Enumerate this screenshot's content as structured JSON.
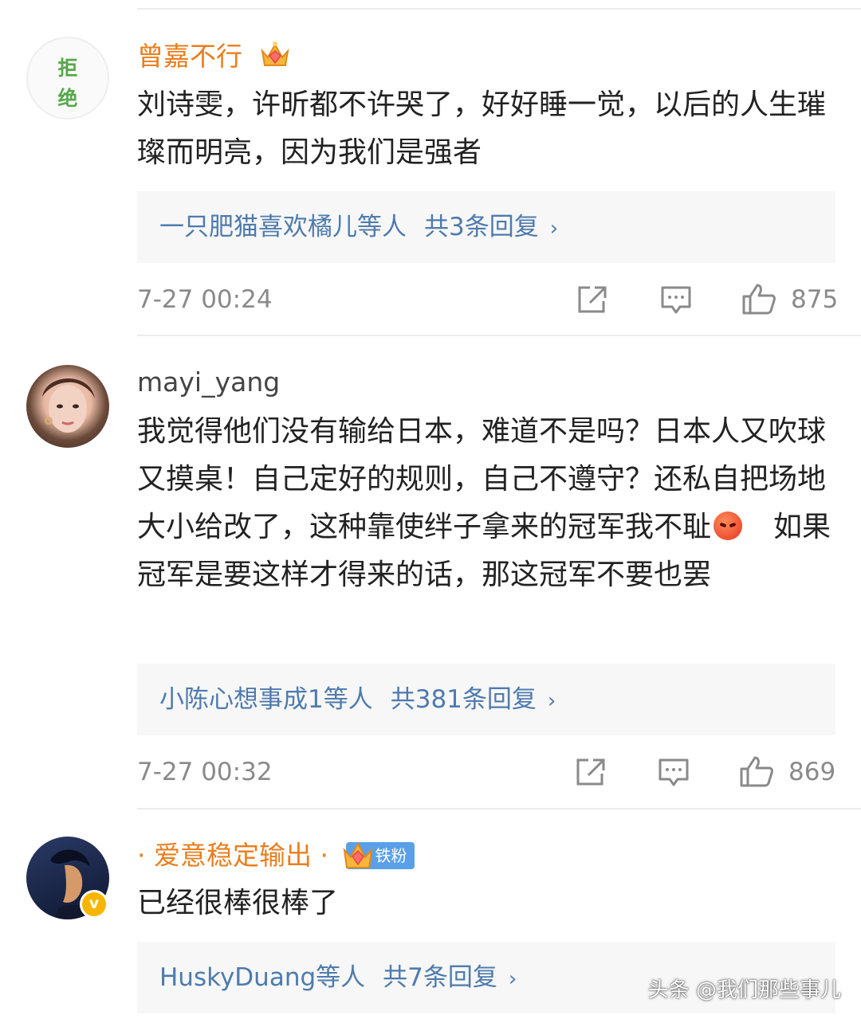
{
  "comments": [
    {
      "avatar_text": [
        "拒",
        "绝"
      ],
      "username": "曾嘉不行",
      "text": "刘诗雯，许昕都不许哭了，好好睡一觉，以后的人生璀璨而明亮，因为我们是强者",
      "reply_users": "一只肥猫喜欢橘儿等人",
      "reply_count": "共3条回复",
      "time": "7-27 00:24",
      "likes": "875"
    },
    {
      "username": "mayi_yang",
      "text_part1": "我觉得他们没有输给日本，难道不是吗？日本人又吹球又摸桌！自己定好的规则，自己不遵守？还私自把场地大小给改了，这种靠使绊子拿来的冠军我不耻",
      "text_part2": "　如果冠军是要这样才得来的话，那这冠军不要也罢",
      "reply_users": "小陈心想事成1等人",
      "reply_count": "共381条回复",
      "time": "7-27 00:32",
      "likes": "869"
    },
    {
      "username": "· 爱意稳定输出 ·",
      "badge": "铁粉",
      "text": "已经很棒很棒了",
      "reply_users": "HuskyDuang等人",
      "reply_count": "共7条回复"
    }
  ],
  "chevron": "›",
  "verified_mark": "v",
  "watermark": "头条 @我们那些事儿",
  "colors": {
    "username_orange": "#ea7e1d",
    "reply_link": "#4e7bae",
    "meta_gray": "#8a8a8a",
    "reply_bg": "#f7f7f7",
    "badge_blue": "#5aa0e8",
    "verified_yellow": "#f7b500"
  },
  "icons": [
    "share-icon",
    "comment-icon",
    "like-icon",
    "crown-icon",
    "angry-emoji-icon",
    "verified-icon"
  ]
}
